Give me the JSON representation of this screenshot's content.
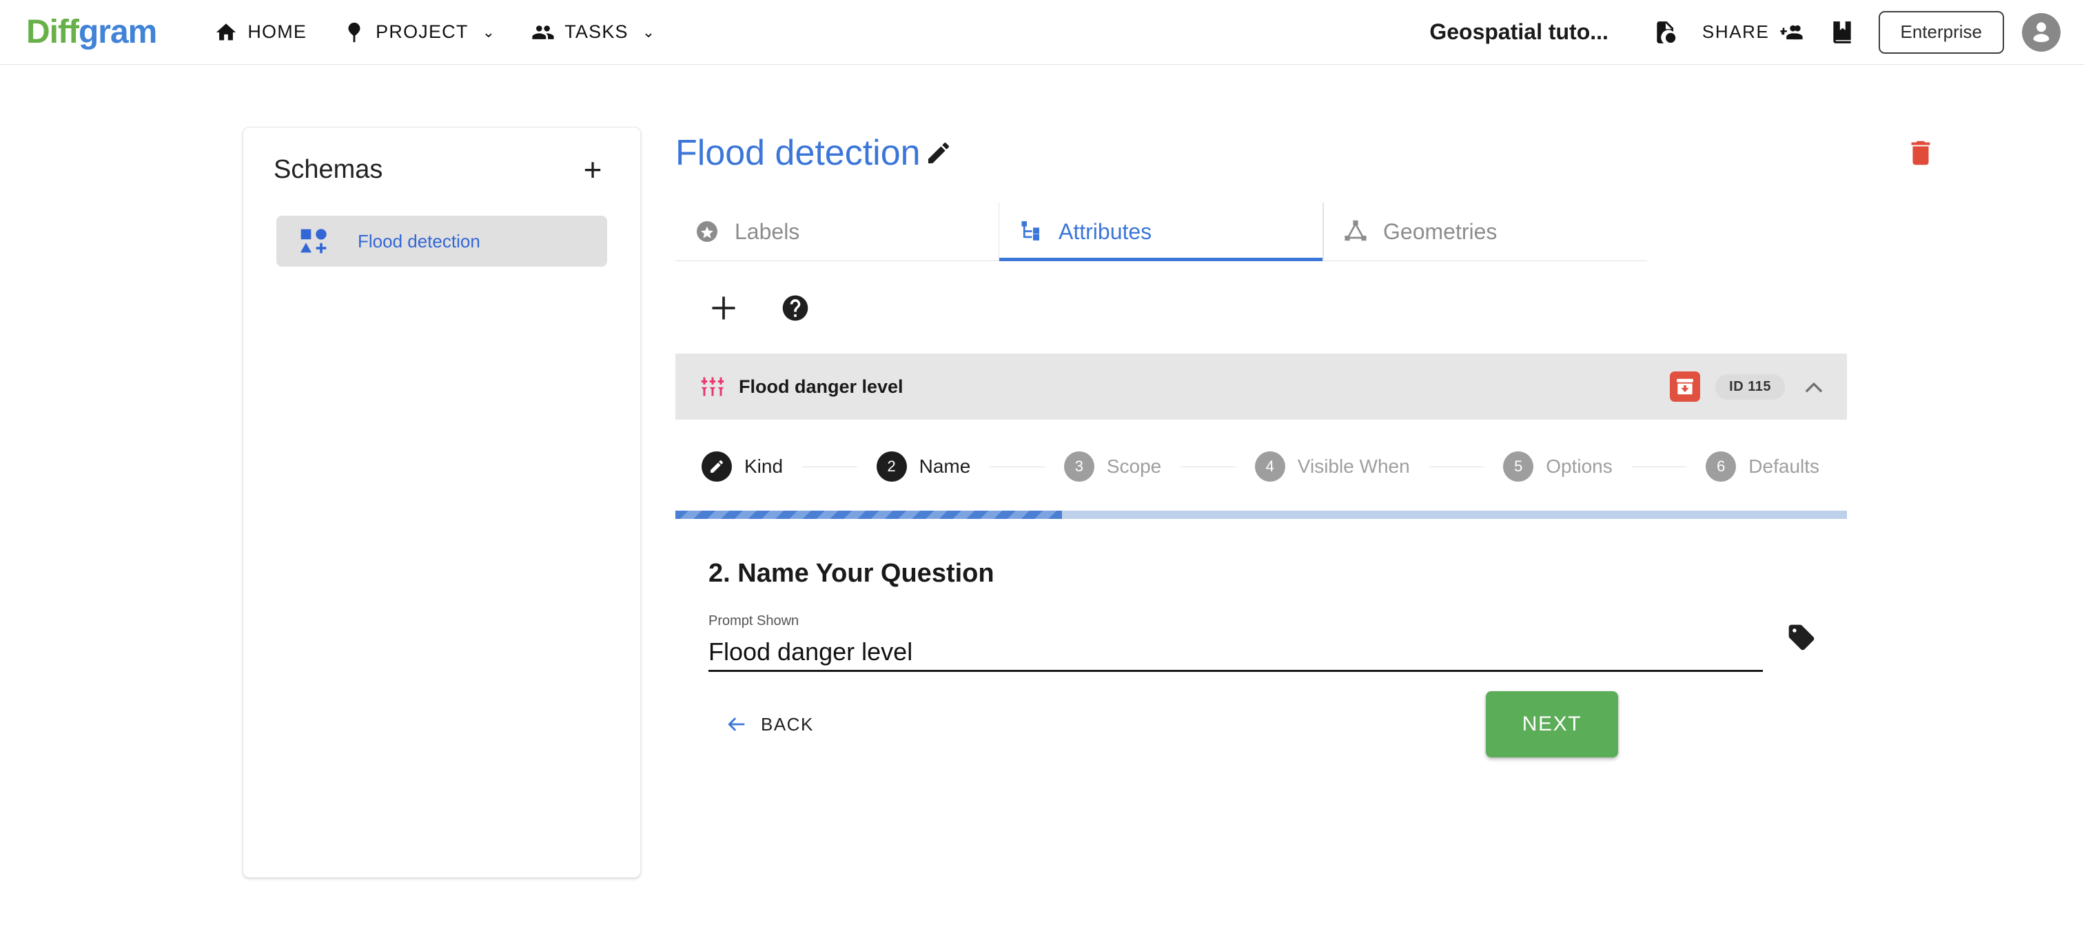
{
  "topbar": {
    "logo": {
      "part1": "Diff",
      "part2": "gram",
      "color1": "#68b04a",
      "color2": "#4183d7"
    },
    "nav": [
      {
        "label": "HOME",
        "icon": "home-icon",
        "has_caret": false
      },
      {
        "label": "PROJECT",
        "icon": "location-pin-icon",
        "has_caret": true,
        "caret": "⌄"
      },
      {
        "label": "TASKS",
        "icon": "people-icon",
        "has_caret": true,
        "caret": "⌄"
      }
    ],
    "project_title": "Geospatial tuto...",
    "history_icon": "document-clock-icon",
    "share_label": "SHARE",
    "share_icon": "person-add-icon",
    "library_icon": "book-bookmark-icon",
    "enterprise_label": "Enterprise",
    "avatar_icon": "account-circle-icon"
  },
  "sidebar": {
    "title": "Schemas",
    "add_label": "+",
    "items": [
      {
        "label": "Flood detection",
        "icon": "shapes-add-icon",
        "selected": true
      }
    ]
  },
  "main": {
    "title": "Flood detection",
    "title_color": "#3b76d8",
    "edit_icon": "pencil-icon",
    "delete_icon": "trash-icon",
    "delete_color": "#e04b3a",
    "tabs": [
      {
        "label": "Labels",
        "icon": "star-circle-icon",
        "active": false
      },
      {
        "label": "Attributes",
        "icon": "account-tree-icon",
        "active": true
      },
      {
        "label": "Geometries",
        "icon": "polygon-vertex-icon",
        "active": false
      }
    ],
    "toolbar": {
      "add_icon": "plus-icon",
      "help_icon": "help-circle-icon"
    },
    "attribute_group": {
      "icon": "tune-sliders-icon",
      "icon_color": "#e8366f",
      "name": "Flood danger level",
      "archive_icon": "archive-download-icon",
      "archive_color": "#e0523f",
      "id_badge": "ID 115",
      "collapse_icon": "chevron-up-icon"
    },
    "stepper": {
      "steps": [
        {
          "num": "1",
          "label": "Kind",
          "state": "done",
          "icon": "pencil-icon"
        },
        {
          "num": "2",
          "label": "Name",
          "state": "active"
        },
        {
          "num": "3",
          "label": "Scope",
          "state": "pending"
        },
        {
          "num": "4",
          "label": "Visible When",
          "state": "pending"
        },
        {
          "num": "5",
          "label": "Options",
          "state": "pending"
        },
        {
          "num": "6",
          "label": "Defaults",
          "state": "pending"
        }
      ],
      "progress_percent": 33
    },
    "form": {
      "heading": "2. Name Your Question",
      "field_label": "Prompt Shown",
      "field_value": "Flood danger level",
      "field_placeholder": "",
      "tag_icon": "tag-icon"
    },
    "actions": {
      "back_label": "BACK",
      "back_icon": "arrow-left-icon",
      "next_label": "NEXT",
      "next_color": "#5cad58"
    }
  }
}
